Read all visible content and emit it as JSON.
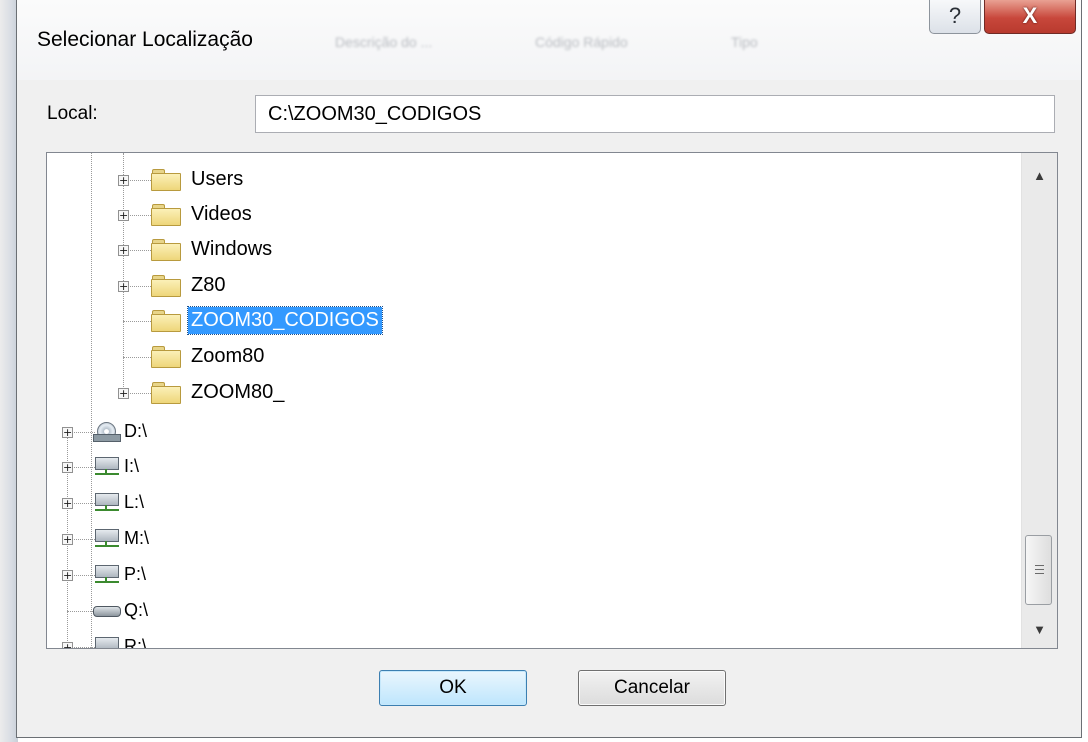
{
  "window": {
    "title": "Selecionar Localização",
    "help_glyph": "?",
    "close_glyph": "X",
    "background_columns": [
      "Descrição do ...",
      "Código Rápido",
      "Tipo"
    ]
  },
  "location": {
    "label": "Local:",
    "value": "C:\\ZOOM30_CODIGOS"
  },
  "tree": {
    "items": [
      {
        "label": "Users",
        "icon": "folder-icon",
        "expandable": true
      },
      {
        "label": "Videos",
        "icon": "folder-icon",
        "expandable": true
      },
      {
        "label": "Windows",
        "icon": "folder-icon",
        "expandable": true
      },
      {
        "label": "Z80",
        "icon": "folder-icon",
        "expandable": true
      },
      {
        "label": "ZOOM30_CODIGOS",
        "icon": "folder-icon",
        "expandable": false,
        "selected": true
      },
      {
        "label": "Zoom80",
        "icon": "folder-icon",
        "expandable": false
      },
      {
        "label": "ZOOM80_",
        "icon": "folder-icon",
        "expandable": true
      },
      {
        "label": "D:\\",
        "icon": "cd-drive-icon",
        "expandable": true
      },
      {
        "label": "I:\\",
        "icon": "network-drive-icon",
        "expandable": true
      },
      {
        "label": "L:\\",
        "icon": "network-drive-icon",
        "expandable": true
      },
      {
        "label": "M:\\",
        "icon": "network-drive-icon",
        "expandable": true
      },
      {
        "label": "P:\\",
        "icon": "network-drive-icon",
        "expandable": true
      },
      {
        "label": "Q:\\",
        "icon": "drive-icon",
        "expandable": false
      },
      {
        "label": "R:\\",
        "icon": "network-drive-icon",
        "expandable": true
      }
    ]
  },
  "buttons": {
    "ok": "OK",
    "cancel": "Cancelar"
  },
  "colors": {
    "selection": "#3399ff",
    "close_button": "#c8473b",
    "ok_border": "#3c7fb1"
  }
}
